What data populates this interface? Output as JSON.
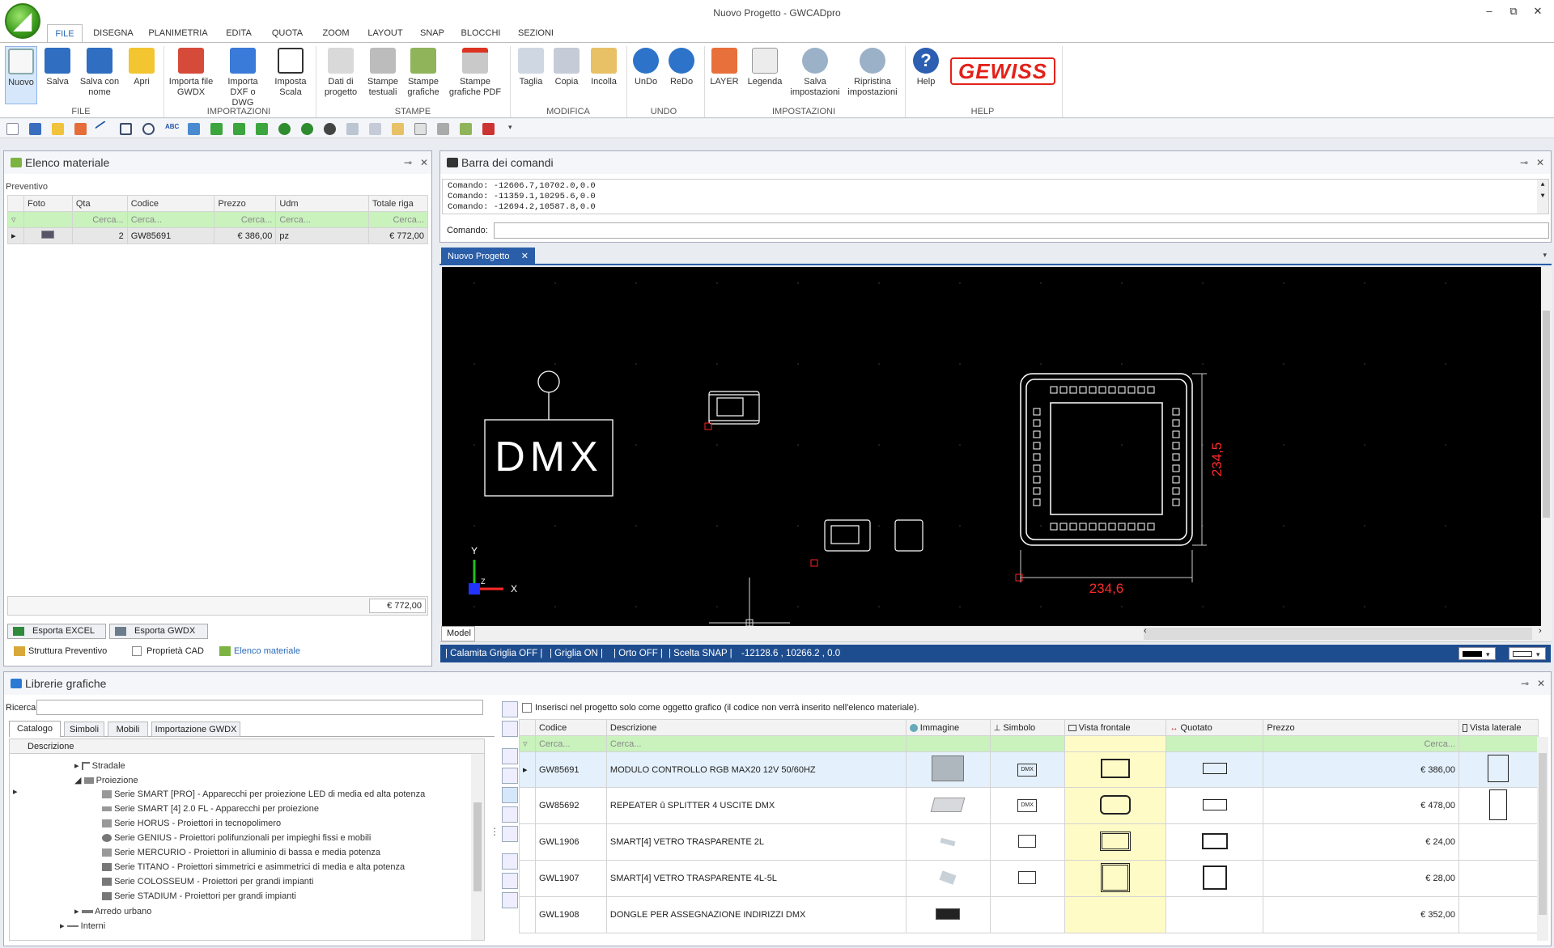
{
  "window": {
    "title": "Nuovo Progetto - GWCADpro",
    "minimize": "‒",
    "restore": "⧉",
    "close": "✕"
  },
  "ribbon_tabs": [
    "FILE",
    "DISEGNA",
    "PLANIMETRIA",
    "EDITA",
    "QUOTA",
    "ZOOM",
    "LAYOUT",
    "SNAP",
    "BLOCCHI",
    "SEZIONI"
  ],
  "ribbon": {
    "buttons": [
      {
        "label": "Nuovo",
        "icon": "new-file-icon"
      },
      {
        "label": "Salva",
        "icon": "save-icon"
      },
      {
        "label": "Salva con nome",
        "icon": "save-as-icon"
      },
      {
        "label": "Apri",
        "icon": "open-folder-icon"
      },
      {
        "label": "Importa file GWDX",
        "icon": "import-gwdx-icon"
      },
      {
        "label": "Importa DXF o DWG",
        "icon": "import-dxf-icon"
      },
      {
        "label": "Imposta Scala",
        "icon": "scale-icon"
      },
      {
        "label": "Dati di progetto",
        "icon": "project-data-icon"
      },
      {
        "label": "Stampe testuali",
        "icon": "print-text-icon"
      },
      {
        "label": "Stampe grafiche",
        "icon": "print-graphics-icon"
      },
      {
        "label": "Stampe grafiche PDF",
        "icon": "print-pdf-icon"
      },
      {
        "label": "Taglia",
        "icon": "cut-icon"
      },
      {
        "label": "Copia",
        "icon": "copy-icon"
      },
      {
        "label": "Incolla",
        "icon": "paste-icon"
      },
      {
        "label": "UnDo",
        "icon": "undo-icon"
      },
      {
        "label": "ReDo",
        "icon": "redo-icon"
      },
      {
        "label": "LAYER",
        "icon": "layer-icon"
      },
      {
        "label": "Legenda",
        "icon": "legend-icon"
      },
      {
        "label": "Salva impostazioni",
        "icon": "save-settings-icon"
      },
      {
        "label": "Ripristina impostazioni",
        "icon": "restore-settings-icon"
      },
      {
        "label": "Help",
        "icon": "help-icon"
      }
    ],
    "groups": [
      "FILE",
      "IMPORTAZIONI",
      "STAMPE",
      "MODIFICA",
      "UNDO",
      "IMPOSTAZIONI",
      "HELP"
    ],
    "brand": "GEWISS"
  },
  "material_panel": {
    "title": "Elenco materiale",
    "section": "Preventivo",
    "columns": [
      "Foto",
      "Qta",
      "Codice",
      "Prezzo",
      "Udm",
      "Totale riga"
    ],
    "filter_placeholder": "Cerca...",
    "rows": [
      {
        "qta": "2",
        "codice": "GW85691",
        "prezzo": "€ 386,00",
        "udm": "pz",
        "totale": "€ 772,00"
      }
    ],
    "total": "€ 772,00",
    "export_excel": "Esporta EXCEL",
    "export_gwdx": "Esporta GWDX",
    "tabs": [
      "Struttura Preventivo",
      "Proprietà CAD",
      "Elenco materiale"
    ]
  },
  "command_panel": {
    "title": "Barra dei comandi",
    "history": [
      "Comando: -12606.7,10702.0,0.0",
      "Comando: -11359.1,10295.6,0.0",
      "Comando: -12694.2,10587.8,0.0"
    ],
    "prompt_label": "Comando:"
  },
  "doc_tab": "Nuovo Progetto",
  "cad": {
    "dmx_text": "DMX",
    "dim_vertical": "234,5",
    "dim_horizontal": "234,6",
    "axis_y": "Y",
    "axis_x": "X",
    "axis_z": "Z",
    "model_tab": "Model"
  },
  "status": {
    "items": [
      "| Calamita Griglia OFF |",
      "| Griglia ON |",
      "| Orto OFF |",
      "| Scelta SNAP |",
      "-12128.6 , 10266.2 , 0.0"
    ]
  },
  "library_panel": {
    "title": "Librerie grafiche",
    "search_label": "Ricerca",
    "tabs": [
      "Catalogo",
      "Simboli",
      "Mobili",
      "Importazione GWDX"
    ],
    "tree_header": "Descrizione",
    "tree": [
      {
        "label": "Stradale",
        "level": 1
      },
      {
        "label": "Proiezione",
        "level": 1
      },
      {
        "label": "Serie SMART [PRO] - Apparecchi per proiezione LED di media ed alta potenza",
        "level": 2
      },
      {
        "label": "Serie SMART [4] 2.0 FL - Apparecchi per proiezione",
        "level": 2
      },
      {
        "label": "Serie HORUS - Proiettori in tecnopolimero",
        "level": 2
      },
      {
        "label": "Serie GENIUS - Proiettori polifunzionali per impieghi fissi e mobili",
        "level": 2
      },
      {
        "label": "Serie MERCURIO - Proiettori in alluminio di bassa e media potenza",
        "level": 2
      },
      {
        "label": "Serie TITANO - Proiettori simmetrici e asimmetrici di media e alta potenza",
        "level": 2
      },
      {
        "label": "Serie COLOSSEUM - Proiettori per grandi impianti",
        "level": 2
      },
      {
        "label": "Serie STADIUM - Proiettori per grandi impianti",
        "level": 2
      },
      {
        "label": "Arredo urbano",
        "level": 1
      },
      {
        "label": "Interni",
        "level": 0
      }
    ],
    "checkbox_label": "Inserisci nel progetto solo come oggetto grafico (il codice non verrà inserito nell'elenco materiale).",
    "columns": [
      "Codice",
      "Descrizione",
      "Immagine",
      "Simbolo",
      "Vista frontale",
      "Quotato",
      "Prezzo",
      "Vista laterale"
    ],
    "filter_placeholder": "Cerca...",
    "rows": [
      {
        "codice": "GW85691",
        "descrizione": "MODULO CONTROLLO RGB MAX20 12V 50/60HZ",
        "prezzo": "€ 386,00"
      },
      {
        "codice": "GW85692",
        "descrizione": "REPEATER û SPLITTER 4 USCITE DMX",
        "prezzo": "€ 478,00"
      },
      {
        "codice": "GWL1906",
        "descrizione": "SMART[4] VETRO TRASPARENTE 2L",
        "prezzo": "€ 24,00"
      },
      {
        "codice": "GWL1907",
        "descrizione": "SMART[4] VETRO TRASPARENTE 4L-5L",
        "prezzo": "€ 28,00"
      },
      {
        "codice": "GWL1908",
        "descrizione": "DONGLE PER ASSEGNAZIONE INDIRIZZI DMX",
        "prezzo": "€ 352,00"
      }
    ]
  },
  "colors": {
    "accent": "#2a6ab8",
    "status_bar": "#1e4d8f",
    "filter_row": "#c9f2bd",
    "cad_bg": "#000000",
    "dimension": "#ff2a2a",
    "brand_red": "#e32119"
  }
}
